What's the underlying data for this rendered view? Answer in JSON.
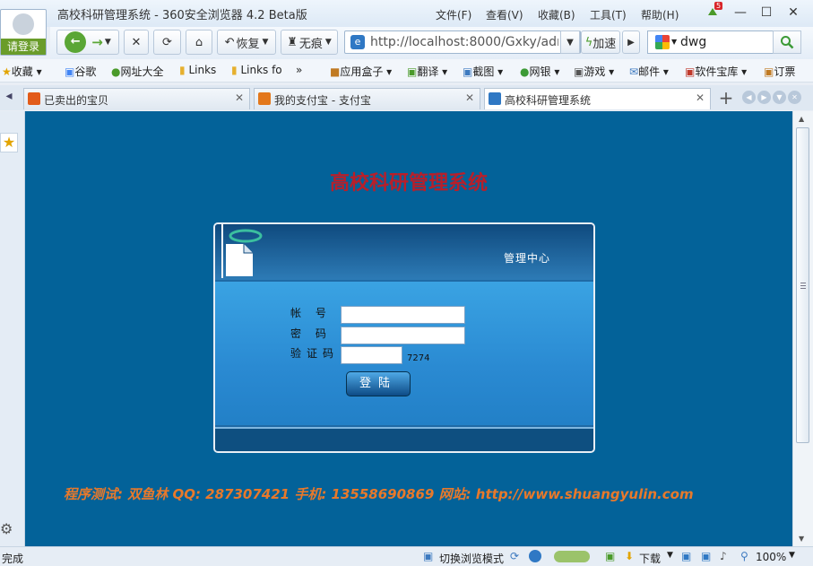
{
  "window": {
    "title": "高校科研管理系统 - 360安全浏览器 4.2 Beta版",
    "login_label": "请登录",
    "menus": [
      "文件(F)",
      "查看(V)",
      "收藏(B)",
      "工具(T)",
      "帮助(H)"
    ],
    "notification_count": "5"
  },
  "nav": {
    "restore_label": "恢复",
    "incognito_label": "无痕",
    "address": "http://localhost:8000/Gxky/adı",
    "accelerate_label": "加速",
    "search_value": "dwg"
  },
  "favorites": [
    "收藏",
    "谷歌",
    "网址大全",
    "Links",
    "Links fo",
    "»",
    "应用盒子",
    "翻译",
    "截图",
    "网银",
    "游戏",
    "邮件",
    "软件宝库",
    "订票"
  ],
  "tabs": [
    {
      "label": "已卖出的宝贝",
      "icon": "taobao-icon",
      "color": "#e25b19"
    },
    {
      "label": "我的支付宝 - 支付宝",
      "icon": "alipay-icon",
      "color": "#e3781c"
    },
    {
      "label": "高校科研管理系统",
      "icon": "ie-page-icon",
      "color": "#2f78c4"
    }
  ],
  "page": {
    "heading": "高校科研管理系统",
    "panel_title": "管理中心",
    "fields": {
      "account_label": "帐  号",
      "password_label": "密  码",
      "captcha_label": "验证码",
      "account_value": "",
      "password_value": "",
      "captcha_value": ""
    },
    "captcha_code": "7274",
    "login_button": "登陆",
    "credits": "程序测试: 双鱼林   QQ: 287307421   手机: 13558690869   网站: http://www.shuangyulin.com"
  },
  "status": {
    "left_text": "完成",
    "mode_label": "切换浏览模式",
    "download_label": "下载",
    "zoom": "100%"
  },
  "colors": {
    "page_bg": "#036299",
    "heading": "#b81f2a",
    "credits": "#e8792b"
  }
}
